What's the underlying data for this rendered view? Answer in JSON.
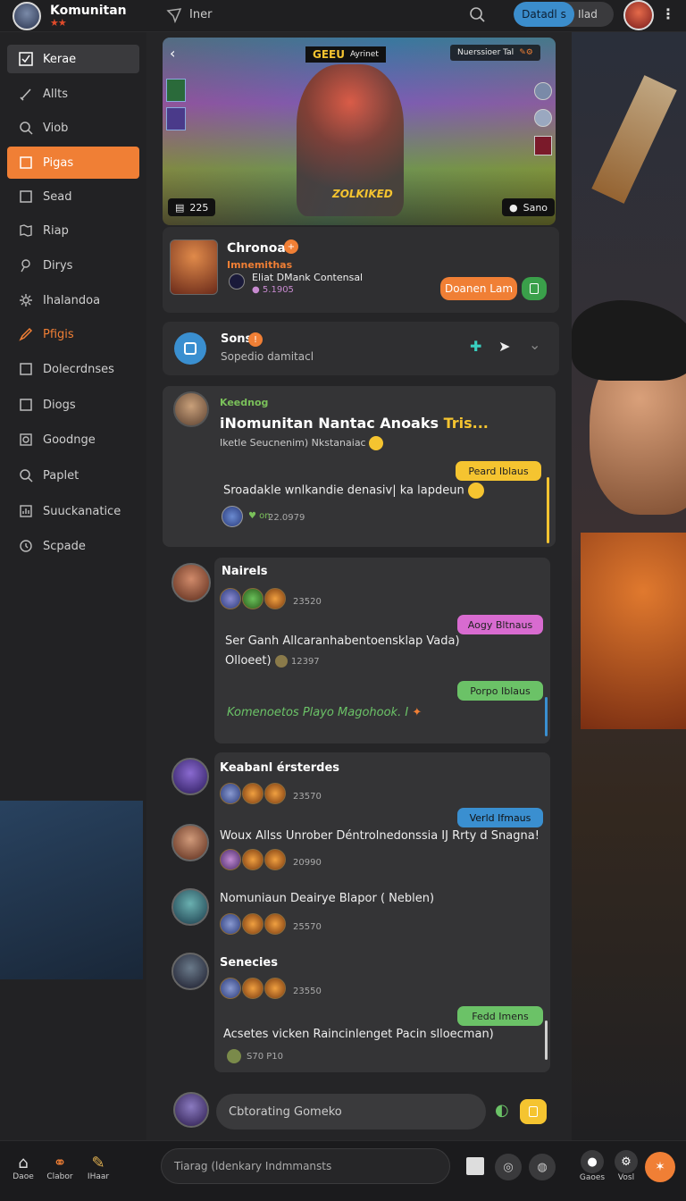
{
  "app": {
    "title": "Komunitan"
  },
  "topbar": {
    "search_text": "Iner",
    "toggle_on": "Datadl s",
    "toggle_off": "Ilad"
  },
  "sidebar": {
    "items": [
      {
        "label": "Kerae",
        "icon": "square-check-icon"
      },
      {
        "label": "Allts",
        "icon": "brush-icon"
      },
      {
        "label": "Viob",
        "icon": "search-icon"
      },
      {
        "label": "Pigas",
        "icon": "folder-icon"
      },
      {
        "label": "Sead",
        "icon": "square-icon"
      },
      {
        "label": "Riap",
        "icon": "map-icon"
      },
      {
        "label": "Dirys",
        "icon": "pin-icon"
      },
      {
        "label": "Ihalandoa",
        "icon": "gear-icon"
      },
      {
        "label": "Pfigis",
        "icon": "pencil-icon"
      },
      {
        "label": "Dolecrdnses",
        "icon": "square-icon"
      },
      {
        "label": "Diogs",
        "icon": "square-icon"
      },
      {
        "label": "Goodnge",
        "icon": "image-icon"
      },
      {
        "label": "Paplet",
        "icon": "search-icon"
      },
      {
        "label": "Suuckanatice",
        "icon": "chart-icon"
      },
      {
        "label": "Scpade",
        "icon": "clock-icon"
      }
    ]
  },
  "banner": {
    "top_label": "Nuerssioer Tal",
    "brand": "GEEU",
    "brand_sub": "Ayrinet",
    "logo_text": "ZOLKIKED",
    "count": "225",
    "sano": "Sano"
  },
  "profile": {
    "name": "Chronoal",
    "subtitle": "Imnemithas",
    "desc": "Eliat DMank Contensal",
    "stat": "5.1905",
    "primary_button": "Doanen Lam"
  },
  "notice": {
    "title": "Sons",
    "subtitle": "Sopedio damitacl"
  },
  "post_main": {
    "category": "Keednog",
    "title_white": "iNomunitan Nantac Anoaks",
    "title_accent": "Tris...",
    "sub": "Iketle Seucnenim) Nkstanaiac",
    "tag": "Peard Iblaus",
    "body": "Sroadakle wnlkandie denasiv| ka lapdeun",
    "reaction_count": "on",
    "time": "22.0979"
  },
  "post_nairels": {
    "name": "Nairels",
    "count": "23520",
    "tag1": "Aogy Bltnaus",
    "body_line1": "Ser Ganh Allcaranhabentoensklap Vada)",
    "body_line2": "Olloeet)",
    "body_count": "12397",
    "tag2": "Porpo Iblaus",
    "italic": "Komenoetos Playo Magohook. I"
  },
  "thread": [
    {
      "name": "Keabanl érsterdes",
      "count": "23570"
    },
    {
      "text": "Woux Allss Unrober Déntrolnedonssia IJ Rrty d Snagna!",
      "count": "20990",
      "tag": "Verld Ifmaus"
    },
    {
      "text": "Nomuniaun Deairye Blapor ( Neblen)",
      "count": "25570"
    },
    {
      "name": "Senecies",
      "count": "23550"
    }
  ],
  "post_last": {
    "tag": "Fedd Imens",
    "body": "Acsetes vicken Raincinlenget Pacin slloecman)",
    "count": "S70 P10"
  },
  "composer": {
    "placeholder": "Cbtorating Gomeko"
  },
  "bottombar": {
    "tabs": [
      {
        "label": "Daoe"
      },
      {
        "label": "Clabor"
      },
      {
        "label": "IHaar"
      }
    ],
    "input": "Tiarag (ldenkary Indmmansts",
    "right_labels": [
      "Gaoes",
      "Vosl"
    ]
  },
  "colors": {
    "accent": "#f07f35",
    "blue": "#3a8fd0",
    "yellow": "#f4c430",
    "green": "#6bc267",
    "pink": "#d86bd0",
    "panel": "#2f2f31"
  }
}
